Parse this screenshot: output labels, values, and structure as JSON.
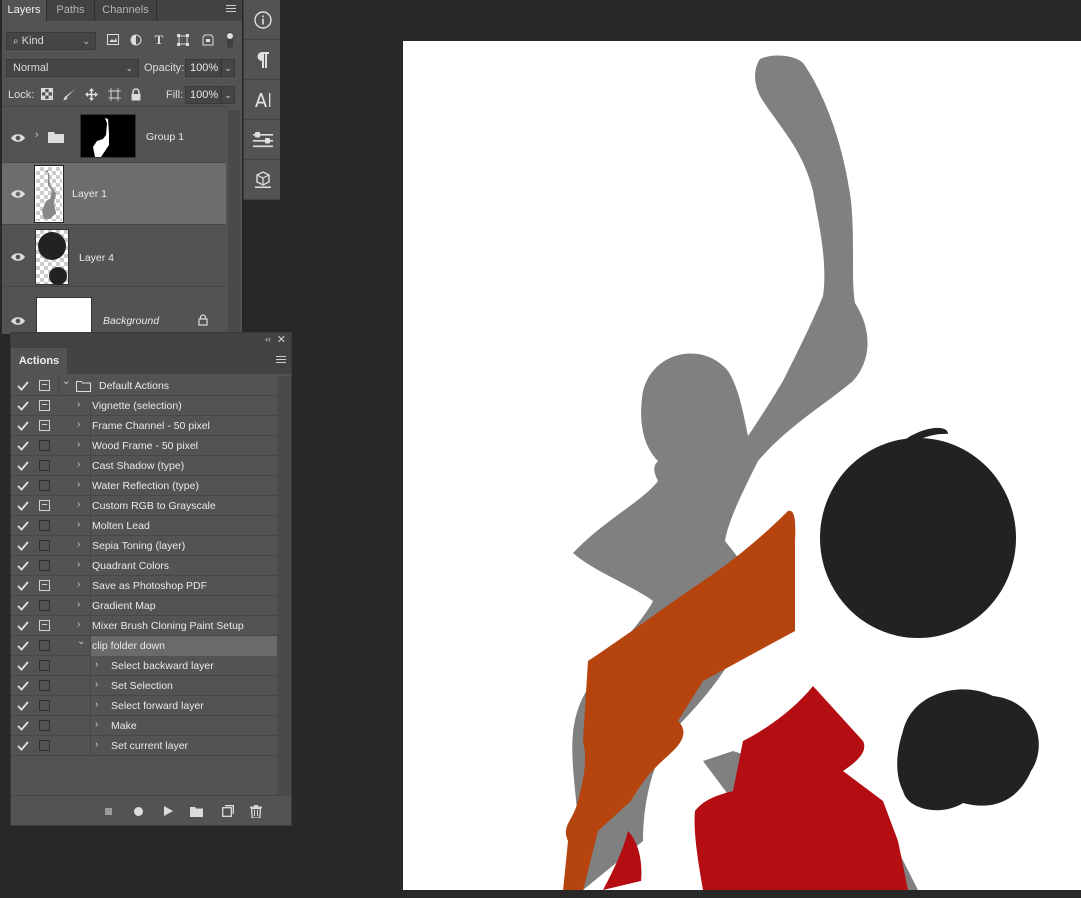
{
  "layers_panel": {
    "tabs": [
      {
        "label": "Layers",
        "active": true
      },
      {
        "label": "Paths",
        "active": false
      },
      {
        "label": "Channels",
        "active": false
      }
    ],
    "filter_label": "Kind",
    "blend_mode": "Normal",
    "opacity_label": "Opacity:",
    "opacity_value": "100%",
    "lock_label": "Lock:",
    "fill_label": "Fill:",
    "fill_value": "100%",
    "layers": [
      {
        "name": "Group 1",
        "type": "group",
        "selected": false
      },
      {
        "name": "Layer 1",
        "type": "layer",
        "selected": true
      },
      {
        "name": "Layer 4",
        "type": "layer",
        "selected": false
      },
      {
        "name": "Background",
        "type": "background",
        "selected": false,
        "locked": true
      }
    ]
  },
  "tool_strip": {
    "buttons": [
      "info-icon",
      "paragraph-icon",
      "character-icon",
      "adjustments-icon",
      "3d-icon"
    ]
  },
  "actions_panel": {
    "tab_label": "Actions",
    "items": [
      {
        "label": "Default Actions",
        "level": 0,
        "dialog": true,
        "expanded": true,
        "folder": true
      },
      {
        "label": "Vignette (selection)",
        "level": 1,
        "dialog": true
      },
      {
        "label": "Frame Channel - 50 pixel",
        "level": 1,
        "dialog": true
      },
      {
        "label": "Wood Frame - 50 pixel",
        "level": 1,
        "dialog": false
      },
      {
        "label": "Cast Shadow (type)",
        "level": 1,
        "dialog": false
      },
      {
        "label": "Water Reflection (type)",
        "level": 1,
        "dialog": false
      },
      {
        "label": "Custom RGB to Grayscale",
        "level": 1,
        "dialog": true
      },
      {
        "label": "Molten Lead",
        "level": 1,
        "dialog": false
      },
      {
        "label": "Sepia Toning (layer)",
        "level": 1,
        "dialog": false
      },
      {
        "label": "Quadrant Colors",
        "level": 1,
        "dialog": false
      },
      {
        "label": "Save as Photoshop PDF",
        "level": 1,
        "dialog": true
      },
      {
        "label": "Gradient Map",
        "level": 1,
        "dialog": false
      },
      {
        "label": "Mixer Brush Cloning Paint Setup",
        "level": 1,
        "dialog": true
      },
      {
        "label": "clip folder down",
        "level": 1,
        "dialog": false,
        "expanded": true,
        "selected": true
      },
      {
        "label": "Select backward layer",
        "level": 2,
        "dialog": false
      },
      {
        "label": "Set Selection",
        "level": 2,
        "dialog": false
      },
      {
        "label": "Select forward layer",
        "level": 2,
        "dialog": false
      },
      {
        "label": "Make",
        "level": 2,
        "dialog": false
      },
      {
        "label": "Set current layer",
        "level": 2,
        "dialog": false
      }
    ],
    "bottom_buttons": [
      "stop-icon",
      "record-icon",
      "play-icon",
      "folder-icon",
      "new-action-icon",
      "trash-icon"
    ]
  },
  "colors": {
    "canvas": "#ffffff",
    "figure_gray": "#808080",
    "orange": "#b5440e",
    "red": "#b40d12",
    "black": "#222222"
  }
}
